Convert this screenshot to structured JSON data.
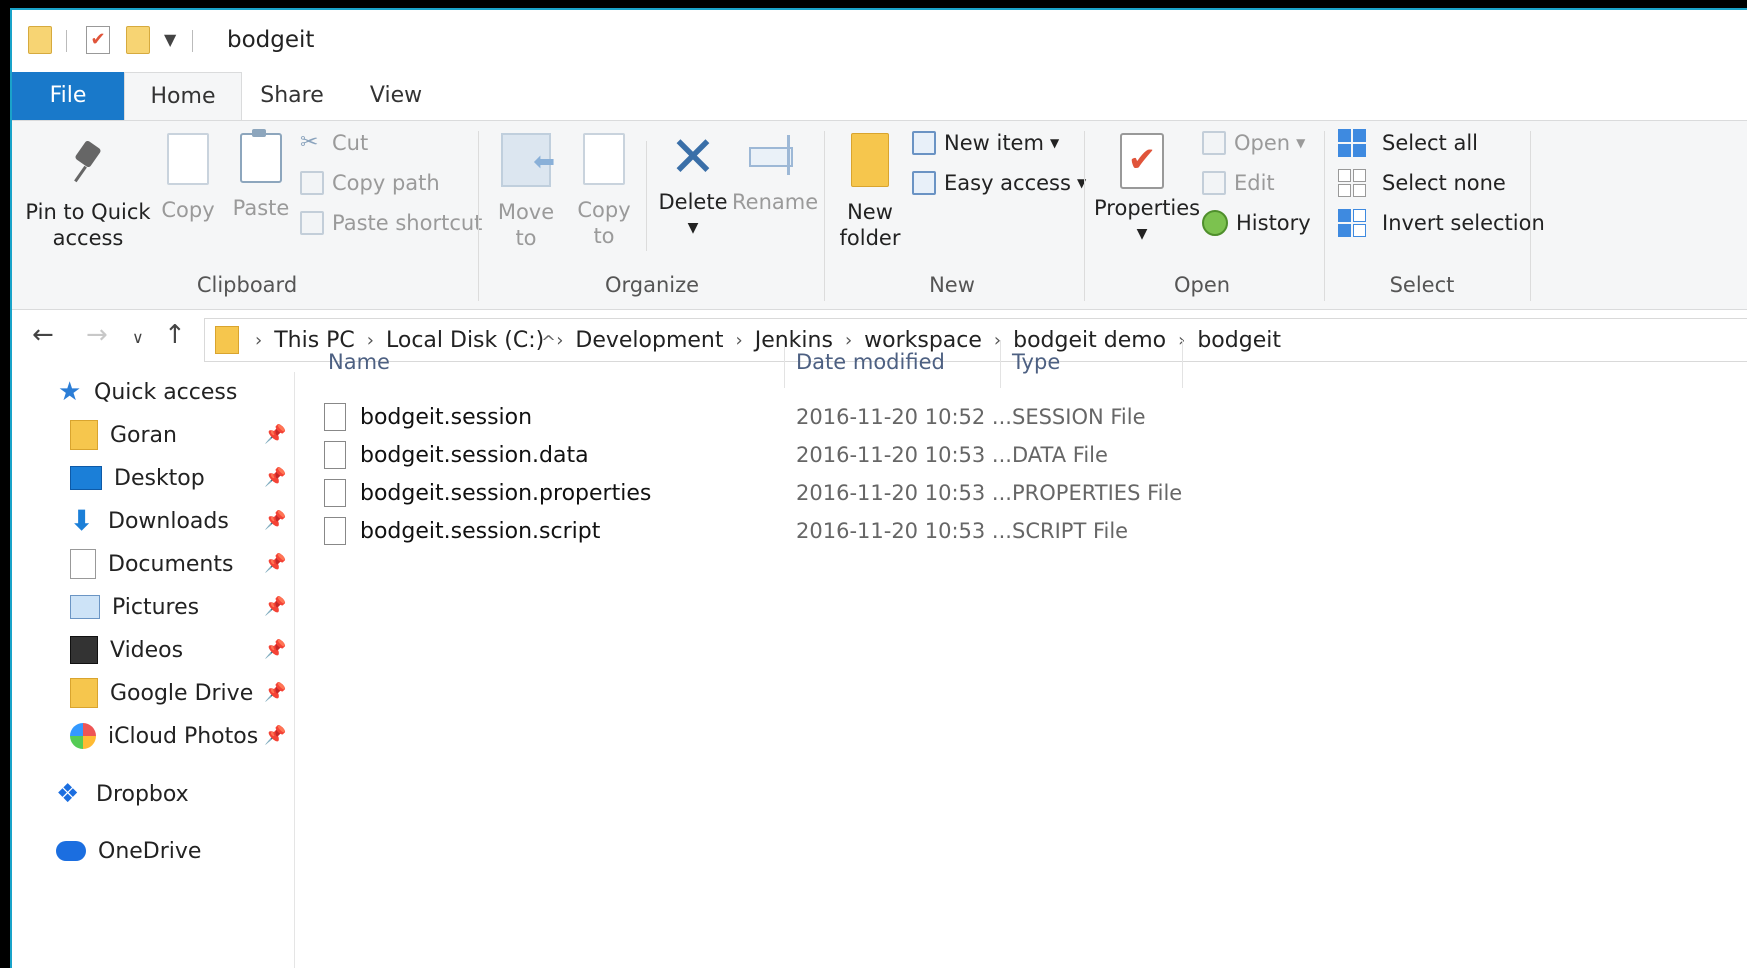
{
  "window": {
    "title": "bodgeit",
    "accent": "#1979ca"
  },
  "tabs": [
    {
      "label": "File"
    },
    {
      "label": "Home"
    },
    {
      "label": "Share"
    },
    {
      "label": "View"
    }
  ],
  "ribbon": {
    "clipboard": {
      "label": "Clipboard",
      "pin_line1": "Pin to Quick",
      "pin_line2": "access",
      "copy": "Copy",
      "paste": "Paste",
      "cut": "Cut",
      "copy_path": "Copy path",
      "paste_shortcut": "Paste shortcut"
    },
    "organize": {
      "label": "Organize",
      "move_line1": "Move",
      "move_line2": "to",
      "copy_line1": "Copy",
      "copy_line2": "to",
      "delete": "Delete",
      "rename": "Rename"
    },
    "new": {
      "label": "New",
      "new_folder_line1": "New",
      "new_folder_line2": "folder",
      "new_item": "New item",
      "easy_access": "Easy access"
    },
    "open": {
      "label": "Open",
      "properties": "Properties",
      "open": "Open",
      "edit": "Edit",
      "history": "History"
    },
    "select": {
      "label": "Select",
      "select_all": "Select all",
      "select_none": "Select none",
      "invert_selection": "Invert selection"
    }
  },
  "address": {
    "crumbs": [
      "This PC",
      "Local Disk (C:)",
      "Development",
      "Jenkins",
      "workspace",
      "bodgeit demo",
      "bodgeit"
    ]
  },
  "nav_pane": {
    "quick_access": "Quick access",
    "items": [
      {
        "label": "Goran",
        "icon": "folder-icon"
      },
      {
        "label": "Desktop",
        "icon": "desktop-icon"
      },
      {
        "label": "Downloads",
        "icon": "download-icon"
      },
      {
        "label": "Documents",
        "icon": "documents-icon"
      },
      {
        "label": "Pictures",
        "icon": "pictures-icon"
      },
      {
        "label": "Videos",
        "icon": "videos-icon"
      },
      {
        "label": "Google Drive",
        "icon": "folder-icon"
      },
      {
        "label": "iCloud Photos",
        "icon": "icloud-photos-icon"
      }
    ],
    "dropbox": "Dropbox",
    "onedrive": "OneDrive"
  },
  "file_list": {
    "columns": [
      "Name",
      "Date modified",
      "Type"
    ],
    "rows": [
      {
        "name": "bodgeit.session",
        "date": "2016-11-20 10:52 ...",
        "type": "SESSION File"
      },
      {
        "name": "bodgeit.session.data",
        "date": "2016-11-20 10:53 ...",
        "type": "DATA File"
      },
      {
        "name": "bodgeit.session.properties",
        "date": "2016-11-20 10:53 ...",
        "type": "PROPERTIES File"
      },
      {
        "name": "bodgeit.session.script",
        "date": "2016-11-20 10:53 ...",
        "type": "SCRIPT File"
      }
    ]
  }
}
